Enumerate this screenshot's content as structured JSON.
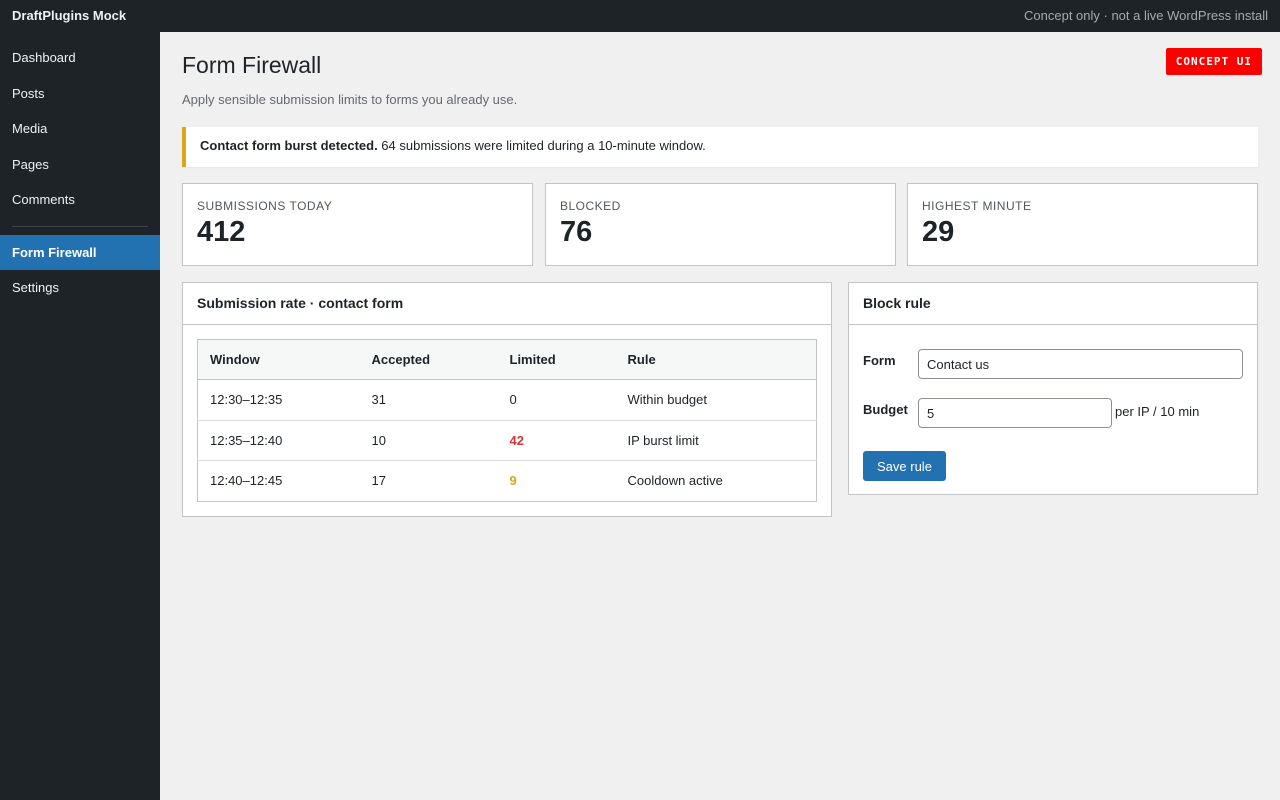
{
  "topbar": {
    "brand": "DraftPlugins Mock",
    "note": "Concept only · not a live WordPress install"
  },
  "sidebar": {
    "items": [
      {
        "label": "Dashboard"
      },
      {
        "label": "Posts"
      },
      {
        "label": "Media"
      },
      {
        "label": "Pages"
      },
      {
        "label": "Comments"
      }
    ],
    "plugin_items": [
      {
        "label": "Form Firewall",
        "active": true
      },
      {
        "label": "Settings",
        "active": false
      }
    ]
  },
  "page": {
    "badge": "CONCEPT UI",
    "title": "Form Firewall",
    "subtitle": "Apply sensible submission limits to forms you already use."
  },
  "notice": {
    "strong": "Contact form burst detected.",
    "text": " 64 submissions were limited during a 10-minute window."
  },
  "stats": [
    {
      "label": "Submissions today",
      "value": "412"
    },
    {
      "label": "Blocked",
      "value": "76"
    },
    {
      "label": "Highest minute",
      "value": "29"
    }
  ],
  "rate_panel": {
    "title": "Submission rate · contact form",
    "columns": [
      "Window",
      "Accepted",
      "Limited",
      "Rule"
    ],
    "rows": [
      {
        "window": "12:30–12:35",
        "accepted": "31",
        "limited": "0",
        "rule": "Within budget"
      },
      {
        "window": "12:35–12:40",
        "accepted": "10",
        "limited": "42",
        "rule": "IP burst limit"
      },
      {
        "window": "12:40–12:45",
        "accepted": "17",
        "limited": "9",
        "rule": "Cooldown active"
      }
    ]
  },
  "rule_panel": {
    "title": "Block rule",
    "form_label": "Form",
    "form_value": "Contact us",
    "budget_label": "Budget",
    "budget_value": "5",
    "budget_suffix": "per IP / 10 min",
    "save_label": "Save rule"
  },
  "colors": {
    "accent": "#2271b1",
    "notice_border": "#dba617",
    "limited_red": "#d63638",
    "limited_amber": "#dba617",
    "badge": "#ff0000"
  }
}
